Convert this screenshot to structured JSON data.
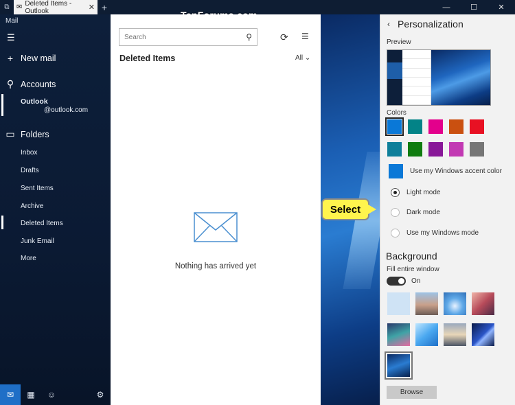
{
  "window": {
    "tab_title": "Deleted Items - Outlook",
    "watermark": "TenForums.com",
    "controls": [
      "—",
      "☐",
      "✕"
    ]
  },
  "nav": {
    "app_name": "Mail",
    "new_mail": "New mail",
    "accounts": "Accounts",
    "account_name": "Outlook",
    "account_email": "@outlook.com",
    "folders_label": "Folders",
    "folders": [
      "Inbox",
      "Drafts",
      "Sent Items",
      "Archive",
      "Deleted Items",
      "Junk Email",
      "More"
    ],
    "selected_folder": "Deleted Items"
  },
  "list": {
    "search_placeholder": "Search",
    "folder_title": "Deleted Items",
    "filter": "All",
    "empty_message": "Nothing has arrived yet"
  },
  "callout": {
    "text": "Select"
  },
  "panel": {
    "title": "Personalization",
    "preview_label": "Preview",
    "colors_label": "Colors",
    "colors_row1": [
      "#0a78d7",
      "#038387",
      "#e3008c",
      "#ca5010",
      "#e81123"
    ],
    "colors_row2": [
      "#0e7f9a",
      "#107c10",
      "#881798",
      "#c239b3",
      "#767676"
    ],
    "selected_color": "#0a78d7",
    "accent_color": "#0a78d7",
    "accent_label": "Use my Windows accent color",
    "modes": [
      "Light mode",
      "Dark mode",
      "Use my Windows mode"
    ],
    "selected_mode": "Light mode",
    "background_title": "Background",
    "fill_label": "Fill entire window",
    "toggle_state": "On",
    "browse_label": "Browse"
  }
}
